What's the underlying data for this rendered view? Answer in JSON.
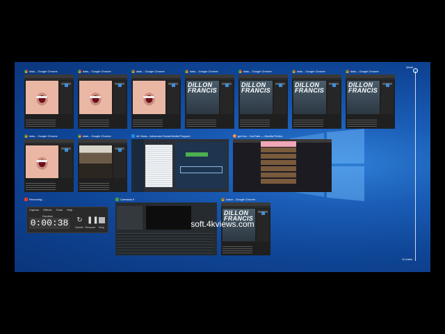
{
  "timeline": {
    "now_label": "Şimdi",
    "date_label": "11 Aralık"
  },
  "footer": {
    "url": "soft.4kviews.com"
  },
  "windows": [
    {
      "title": "data, - Google Chrome",
      "icon": "chrome-icon"
    },
    {
      "title": "data, - Google Chrome",
      "icon": "chrome-icon"
    },
    {
      "title": "data, - Google Chrome",
      "icon": "chrome-icon"
    },
    {
      "title": "data, - Google Chrome",
      "icon": "chrome-icon"
    },
    {
      "title": "data, - Google Chrome",
      "icon": "chrome-icon"
    },
    {
      "title": "data, - Google Chrome",
      "icon": "chrome-icon"
    },
    {
      "title": "data, - Google Chrome",
      "icon": "chrome-icon"
    },
    {
      "title": "data, - Google Chrome",
      "icon": "chrome-icon"
    },
    {
      "title": "data, - Google Chrome",
      "icon": "chrome-icon"
    },
    {
      "title": "4k Views - Advanced Social Media Program",
      "icon": "4kviews-icon"
    },
    {
      "title": "get imo - YouTube — Mozilla Firefox",
      "icon": "firefox-icon"
    },
    {
      "title": "Recording...",
      "icon": "record-icon"
    },
    {
      "title": "Camtasia 9",
      "icon": "camtasia-icon"
    },
    {
      "title": "Aatoz - Google Chrome",
      "icon": "chrome-icon"
    }
  ],
  "poster_text": "DILLON FRANCIS",
  "recorder": {
    "menu": [
      "Capture",
      "Effects",
      "Tools",
      "Help"
    ],
    "duration_label": "Duration",
    "time": "0:00:38",
    "delete_label": "Delete",
    "resume_label": "Resume",
    "stop_label": "Stop"
  }
}
